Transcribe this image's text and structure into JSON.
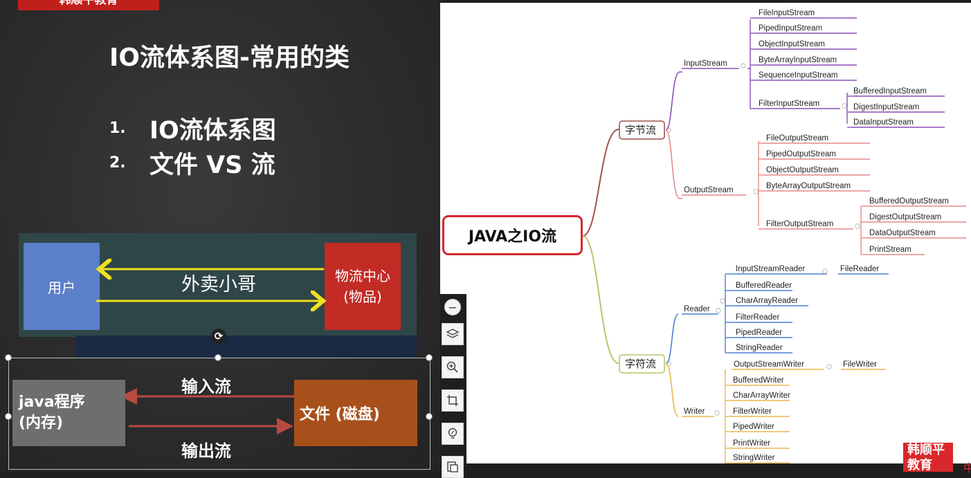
{
  "slide": {
    "tag": "韩顺平教育",
    "title": "IO流体系图-常用的类",
    "topics": [
      {
        "num": "1.",
        "text": "IO流体系图"
      },
      {
        "num": "2.",
        "text": "文件 VS 流"
      }
    ],
    "analogy": {
      "user": "用户",
      "delivery": "外卖小哥",
      "center_line1": "物流中心",
      "center_line2": "(物品)"
    },
    "io": {
      "program_line1": "java程序",
      "program_line2": "(内存)",
      "file": "文件 (磁盘)",
      "input": "输入流",
      "output": "输出流"
    },
    "rotate_icon": "rotate-icon"
  },
  "mindmap": {
    "root": "JAVA之IO流",
    "byte_stream": "字节流",
    "char_stream": "字符流",
    "input_stream": "InputStream",
    "output_stream": "OutputStream",
    "reader": "Reader",
    "writer": "Writer",
    "input_children": [
      "FileInputStream",
      "PipedInputStream",
      "ObjectInputStream",
      "ByteArrayInputStream",
      "SequenceInputStream"
    ],
    "filter_input": "FilterInputStream",
    "filter_input_children": [
      "BufferedInputStream",
      "DigestInputStream",
      "DataInputStream"
    ],
    "output_children": [
      "FileOutputStream",
      "PipedOutputStream",
      "ObjectOutputStream",
      "ByteArrayOutputStream"
    ],
    "filter_output": "FilterOutputStream",
    "filter_output_children": [
      "BufferedOutputStream",
      "DigestOutputStream",
      "DataOutputStream",
      "PrintStream"
    ],
    "isr": "InputStreamReader",
    "file_reader": "FileReader",
    "reader_children": [
      "BufferedReader",
      "CharArrayReader",
      "FilterReader",
      "PipedReader",
      "StringReader"
    ],
    "osw": "OutputStreamWriter",
    "file_writer": "FileWriter",
    "writer_children": [
      "BufferedWriter",
      "CharArrayWriter",
      "FilterWriter",
      "PipedWriter",
      "PrintWriter",
      "StringWriter"
    ],
    "colors": {
      "byte_branch": "#a0524d",
      "input": "#8a4fb8",
      "output": "#e38a8a",
      "char_branch": "#b9c46a",
      "reader": "#4a7fd1",
      "writer": "#e8b84a",
      "root_border": "#d5262e"
    }
  },
  "toolbar": {
    "icons": [
      "zoom-out-icon",
      "layers-icon",
      "zoom-in-icon",
      "crop-icon",
      "idea-icon",
      "export-icon"
    ]
  },
  "watermark": {
    "line1": "韩顺平",
    "line2": "教育",
    "tail": "中"
  }
}
